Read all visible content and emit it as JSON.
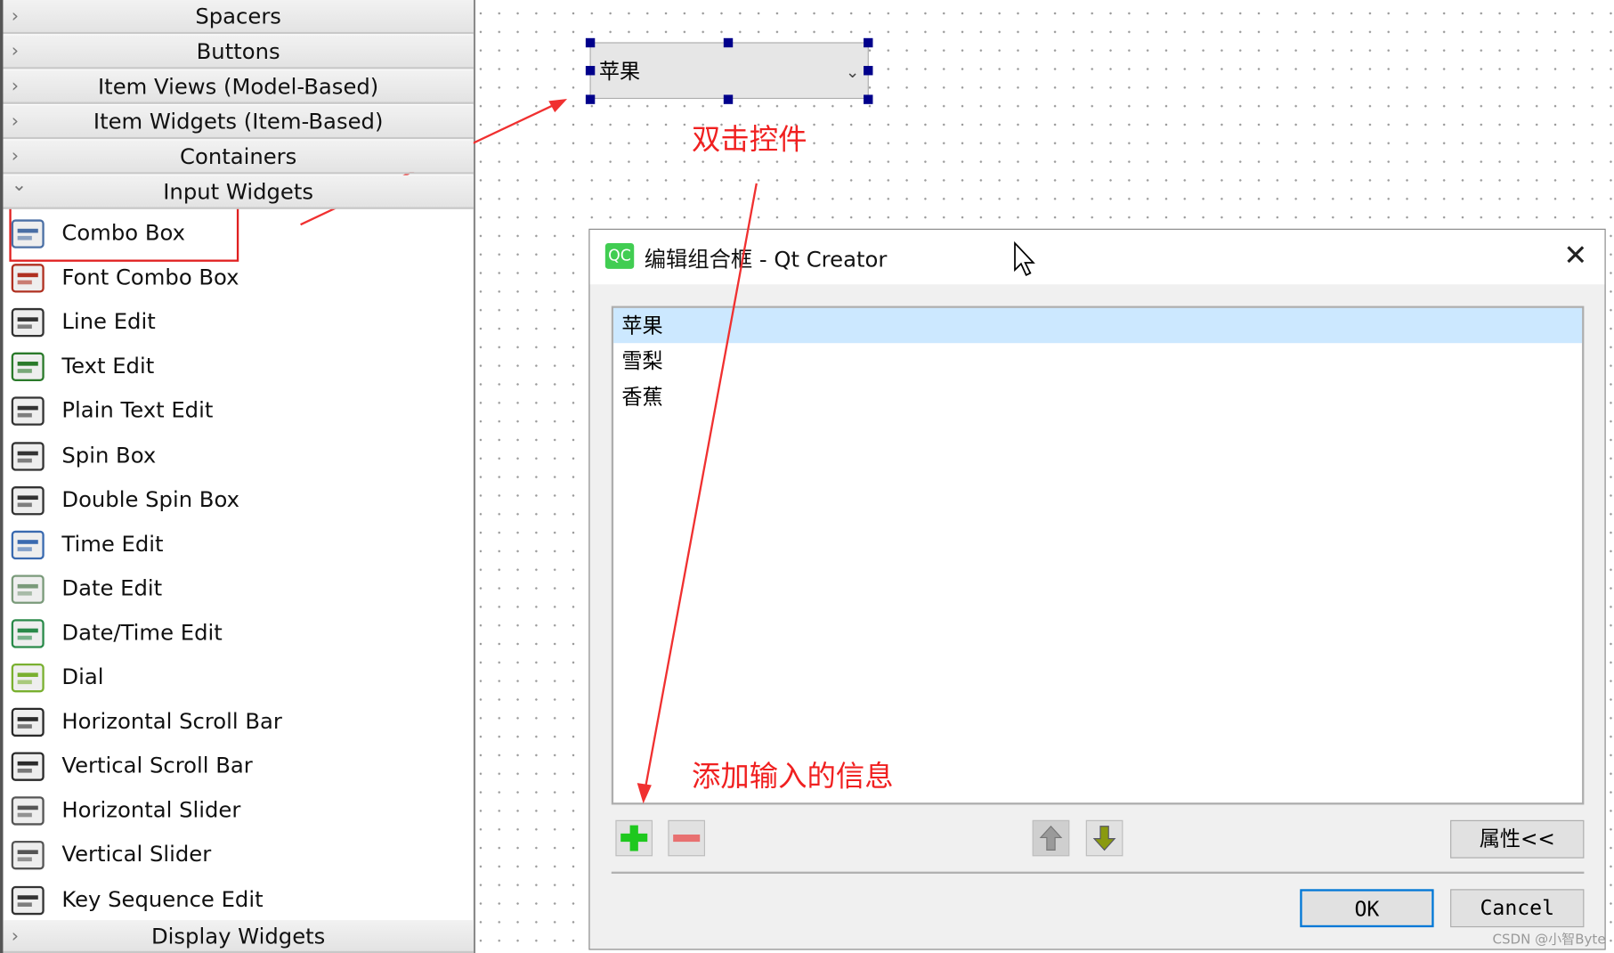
{
  "widget_box": {
    "categories_top": [
      {
        "label": "Spacers"
      },
      {
        "label": "Buttons"
      },
      {
        "label": "Item Views (Model-Based)"
      },
      {
        "label": "Item Widgets (Item-Based)"
      },
      {
        "label": "Containers"
      },
      {
        "label": "Input Widgets",
        "expanded": true
      }
    ],
    "items": [
      {
        "label": "Combo Box",
        "icon": "combo-box-icon"
      },
      {
        "label": "Font Combo Box",
        "icon": "font-combo-box-icon"
      },
      {
        "label": "Line Edit",
        "icon": "line-edit-icon"
      },
      {
        "label": "Text Edit",
        "icon": "text-edit-icon"
      },
      {
        "label": "Plain Text Edit",
        "icon": "plain-text-edit-icon"
      },
      {
        "label": "Spin Box",
        "icon": "spin-box-icon"
      },
      {
        "label": "Double Spin Box",
        "icon": "double-spin-box-icon"
      },
      {
        "label": "Time Edit",
        "icon": "clock-icon"
      },
      {
        "label": "Date Edit",
        "icon": "calendar-icon"
      },
      {
        "label": "Date/Time Edit",
        "icon": "calendar-clock-icon"
      },
      {
        "label": "Dial",
        "icon": "dial-icon"
      },
      {
        "label": "Horizontal Scroll Bar",
        "icon": "horizontal-scrollbar-icon"
      },
      {
        "label": "Vertical Scroll Bar",
        "icon": "vertical-scrollbar-icon"
      },
      {
        "label": "Horizontal Slider",
        "icon": "horizontal-slider-icon"
      },
      {
        "label": "Vertical Slider",
        "icon": "vertical-slider-icon"
      },
      {
        "label": "Key Sequence Edit",
        "icon": "key-sequence-icon"
      }
    ],
    "category_bottom": "Display Widgets"
  },
  "canvas": {
    "combo_value": "苹果",
    "annotation_double_click": "双击控件",
    "annotation_add_info": "添加输入的信息"
  },
  "dialog": {
    "title": "编辑组合框 - Qt Creator",
    "app_icon_text": "QC",
    "items": [
      "苹果",
      "雪梨",
      "香蕉"
    ],
    "selected_index": 0,
    "properties_button": "属性<<",
    "ok": "OK",
    "cancel": "Cancel"
  },
  "watermark": "CSDN @小智Byte",
  "colors": {
    "annotation": "#f02020",
    "selection": "#cce8ff",
    "ok_border": "#0078d7"
  }
}
